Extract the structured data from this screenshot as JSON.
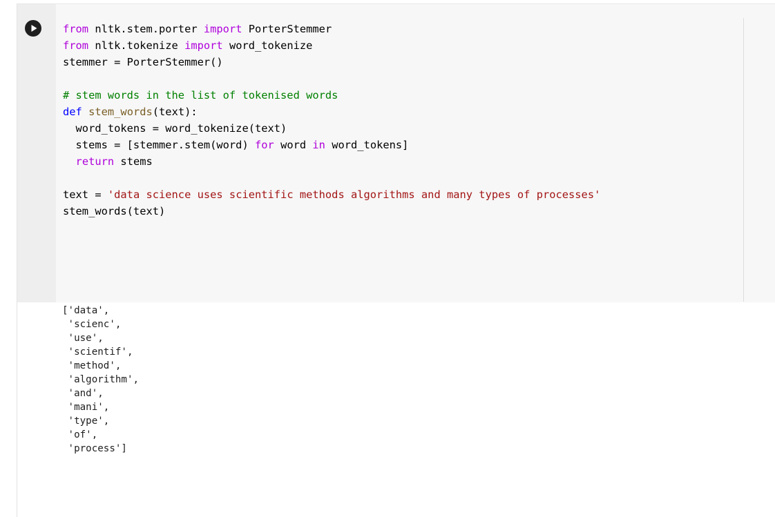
{
  "cell": {
    "run_button": {
      "icon": "play-icon",
      "color": "#1f1f1f"
    },
    "code": [
      [
        {
          "t": "from",
          "c": "kw"
        },
        {
          "t": " nltk.stem.porter ",
          "c": ""
        },
        {
          "t": "import",
          "c": "kw"
        },
        {
          "t": " PorterStemmer",
          "c": ""
        }
      ],
      [
        {
          "t": "from",
          "c": "kw"
        },
        {
          "t": " nltk.tokenize ",
          "c": ""
        },
        {
          "t": "import",
          "c": "kw"
        },
        {
          "t": " word_tokenize",
          "c": ""
        }
      ],
      [
        {
          "t": "stemmer = PorterStemmer()",
          "c": ""
        }
      ],
      [],
      [
        {
          "t": "# stem words in the list of tokenised words",
          "c": "cm"
        }
      ],
      [
        {
          "t": "def",
          "c": "def"
        },
        {
          "t": " ",
          "c": ""
        },
        {
          "t": "stem_words",
          "c": "fn"
        },
        {
          "t": "(text):",
          "c": ""
        }
      ],
      [
        {
          "t": "  word_tokens = word_tokenize(text)",
          "c": ""
        }
      ],
      [
        {
          "t": "  stems = [stemmer.stem(word) ",
          "c": ""
        },
        {
          "t": "for",
          "c": "kw"
        },
        {
          "t": " word ",
          "c": ""
        },
        {
          "t": "in",
          "c": "kw"
        },
        {
          "t": " word_tokens]",
          "c": ""
        }
      ],
      [
        {
          "t": "  ",
          "c": ""
        },
        {
          "t": "return",
          "c": "kw"
        },
        {
          "t": " stems",
          "c": ""
        }
      ],
      [],
      [
        {
          "t": "text = ",
          "c": ""
        },
        {
          "t": "'data science uses scientific methods algorithms and many types of processes'",
          "c": "str"
        }
      ],
      [
        {
          "t": "stem_words(text)",
          "c": ""
        }
      ]
    ],
    "output": [
      "['data',",
      " 'scienc',",
      " 'use',",
      " 'scientif',",
      " 'method',",
      " 'algorithm',",
      " 'and',",
      " 'mani',",
      " 'type',",
      " 'of',",
      " 'process']"
    ]
  },
  "colors": {
    "keyword": "#af00db",
    "def_keyword": "#0000ff",
    "string": "#a31515",
    "comment": "#008000",
    "function_name": "#795e26",
    "editor_background": "#f7f7f7",
    "gutter_background": "#eeeeee"
  }
}
